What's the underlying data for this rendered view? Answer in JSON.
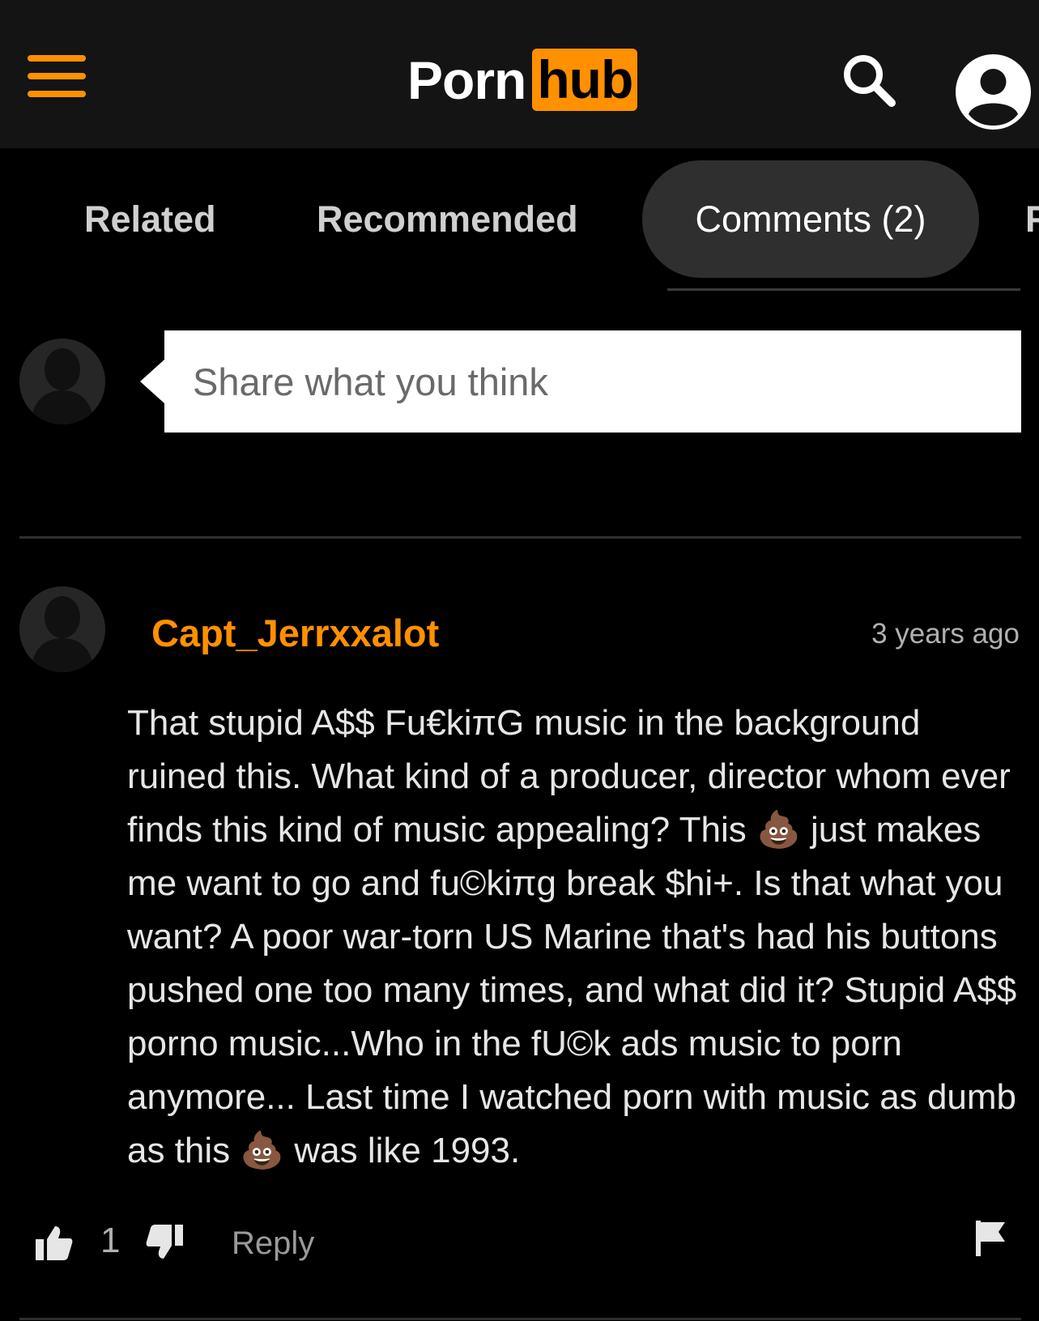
{
  "header": {
    "logo_left": "Porn",
    "logo_right": "hub",
    "menu_icon": "hamburger-menu-icon",
    "search_icon": "search-icon",
    "account_icon": "user-account-icon",
    "accent_color": "#ff9000"
  },
  "tabs": [
    {
      "label": "Related",
      "active": false
    },
    {
      "label": "Recommended",
      "active": false
    },
    {
      "label": "Comments (2)",
      "active": true
    },
    {
      "label": "F",
      "active": false
    }
  ],
  "composer": {
    "placeholder": "Share what you think",
    "avatar_icon": "default-avatar-icon"
  },
  "comment": {
    "username": "Capt_Jerrxxalot",
    "timestamp": "3 years ago",
    "body": "That stupid A$$ Fu€kiπG music in the background ruined this. What kind of a producer, director whom ever finds this kind of music appealing? This 💩 just makes me want to go and fu©kiπg break $hi+. Is that what you want? A poor war-torn US Marine that's had his buttons pushed one too many times, and what did it? Stupid A$$ porno music...Who in the fU©k ads music to porn anymore... Last time I watched porn with music as dumb as this 💩 was like 1993.",
    "likes": "1",
    "reply_label": "Reply",
    "like_icon": "thumbs-up-icon",
    "dislike_icon": "thumbs-down-icon",
    "flag_icon": "flag-icon"
  }
}
